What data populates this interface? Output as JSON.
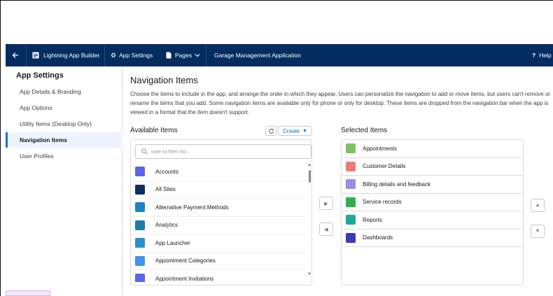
{
  "topbar": {
    "back_icon": "back-arrow-icon",
    "app_builder": "Lightning App Builder",
    "app_settings": "App Settings",
    "pages": "Pages",
    "app_name": "Garage Management Application",
    "help": "Help"
  },
  "sidebar": {
    "title": "App Settings",
    "items": [
      {
        "label": "App Details & Branding"
      },
      {
        "label": "App Options"
      },
      {
        "label": "Utility Items (Desktop Only)"
      },
      {
        "label": "Navigation Items"
      },
      {
        "label": "User Profiles"
      }
    ],
    "active_index": 3
  },
  "main": {
    "heading": "Navigation Items",
    "description": "Choose the items to include in the app, and arrange the order in which they appear. Users can personalize the navigation to add or move items, but users can't remove or rename the items that you add. Some navigation items are available only for phone or only for desktop. These items are dropped from the navigation bar when the app is viewed in a format that the item doesn't support.",
    "available_label": "Available Items",
    "create_label": "Create",
    "search_placeholder": "type to filter list...",
    "selected_label": "Selected Items",
    "available_items": [
      {
        "label": "Accounts",
        "color": "#5867e8"
      },
      {
        "label": "All Sites",
        "color": "#0b2e5a"
      },
      {
        "label": "Alternative Payment Methods",
        "color": "#1b82c6"
      },
      {
        "label": "Analytics",
        "color": "#1a7fa6"
      },
      {
        "label": "App Launcher",
        "color": "#2a8fd3"
      },
      {
        "label": "Appointment Categories",
        "color": "#3f93ea"
      },
      {
        "label": "Appointment Invitations",
        "color": "#5867e8"
      }
    ],
    "selected_items": [
      {
        "label": "Appointments",
        "color": "#7fc15f"
      },
      {
        "label": "Customer Details",
        "color": "#f07c73"
      },
      {
        "label": "Billing details and feedback",
        "color": "#9b8ce6"
      },
      {
        "label": "Service records",
        "color": "#2bb34a"
      },
      {
        "label": "Reports",
        "color": "#1fa998"
      },
      {
        "label": "Dashboards",
        "color": "#3b3bb5"
      }
    ]
  },
  "colors": {
    "topbar": "#032d60",
    "accent": "#0176d3"
  }
}
